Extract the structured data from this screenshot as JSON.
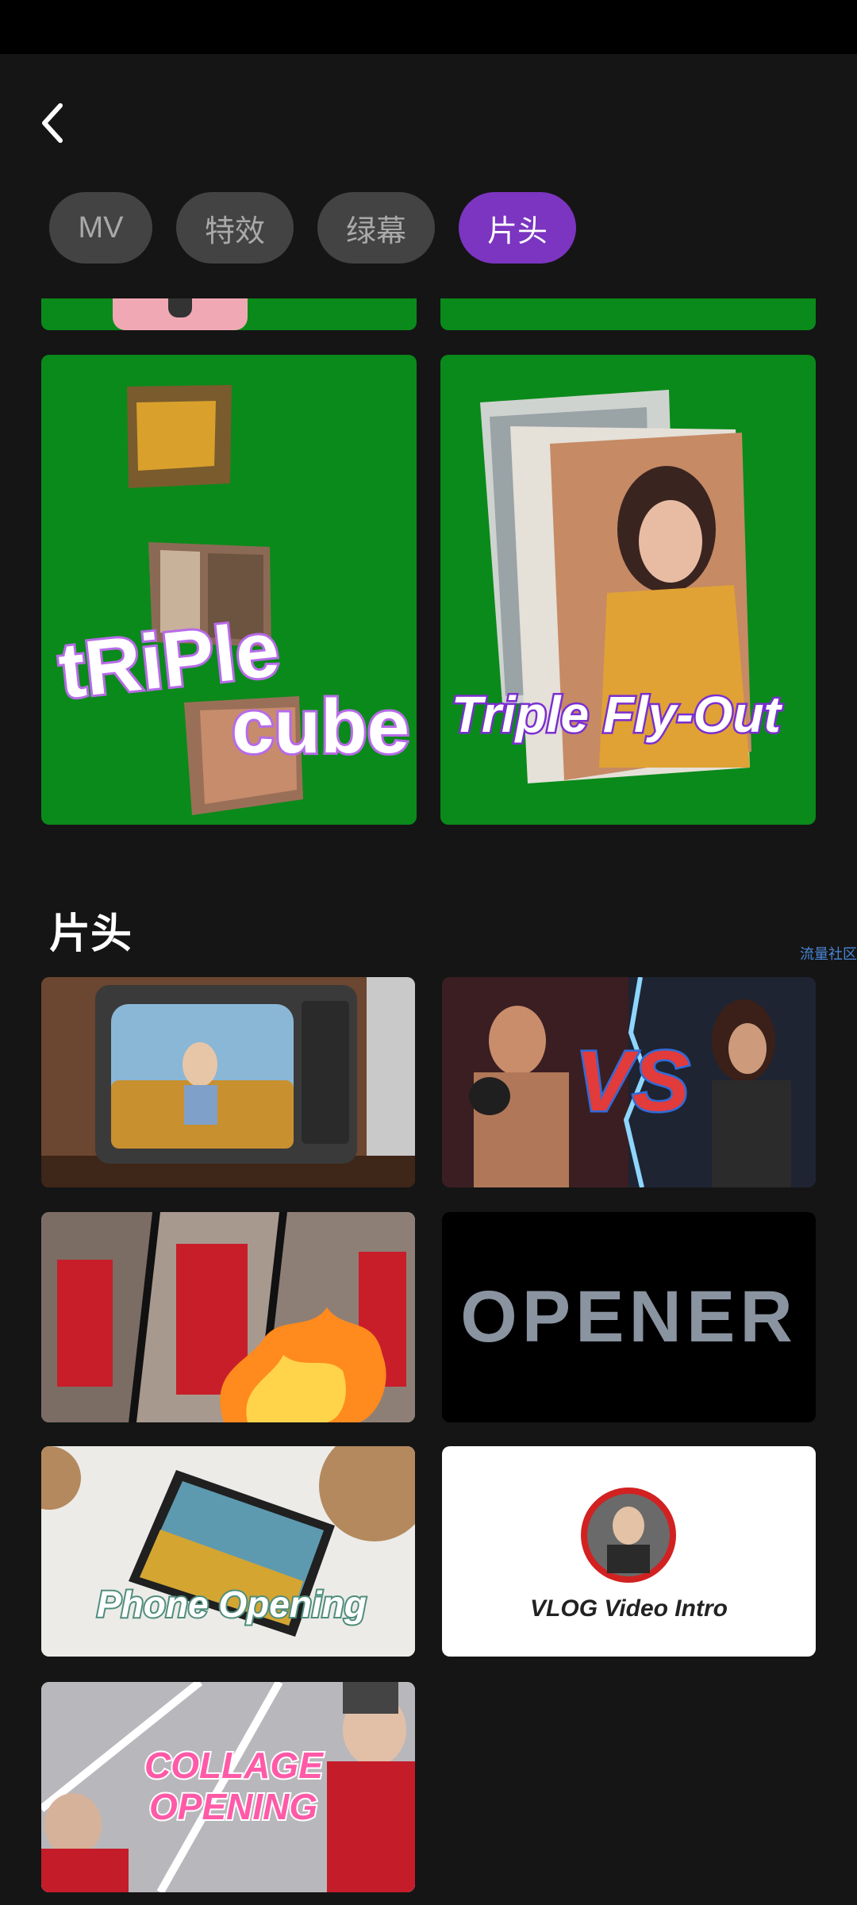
{
  "tabs": [
    {
      "label": "MV",
      "active": false
    },
    {
      "label": "特效",
      "active": false
    },
    {
      "label": "绿幕",
      "active": false
    },
    {
      "label": "片头",
      "active": true
    }
  ],
  "green_screen": {
    "cards": [
      {
        "title_line1": "tRiPle",
        "title_line2": "cube"
      },
      {
        "title": "Triple Fly-Out"
      }
    ]
  },
  "section": {
    "title": "片头"
  },
  "watermark": "流量社区",
  "intro_cards": [
    {
      "text": ""
    },
    {
      "text": "VS"
    },
    {
      "text": ""
    },
    {
      "text": "OPENER"
    },
    {
      "text": "Phone Opening"
    },
    {
      "text": "VLOG Video Intro"
    },
    {
      "line1": "COLLAGE",
      "line2": "OPENING"
    }
  ],
  "icons": {
    "back": "chevron-left-icon"
  },
  "colors": {
    "background": "#151515",
    "accent": "#7b35c1",
    "green_screen": "#0a8a1a"
  }
}
